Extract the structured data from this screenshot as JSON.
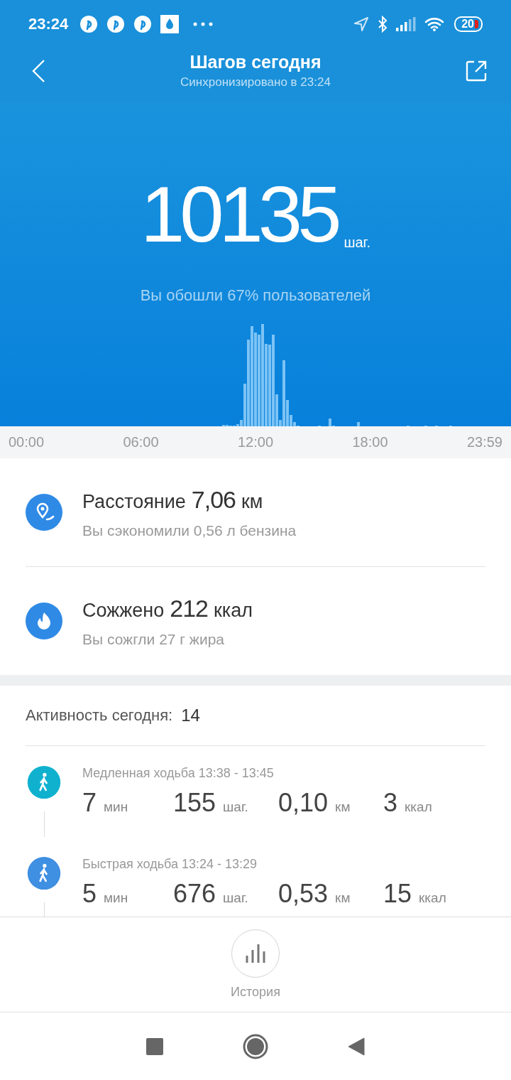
{
  "status_bar": {
    "time": "23:24",
    "battery": "20"
  },
  "header": {
    "title": "Шагов сегодня",
    "subtitle": "Синхронизировано в 23:24"
  },
  "steps": {
    "value": "10135",
    "unit": "шаг.",
    "comparison": "Вы обошли 67% пользователей"
  },
  "axis_labels": [
    "00:00",
    "06:00",
    "12:00",
    "18:00",
    "23:59"
  ],
  "stats": [
    {
      "kind": "distance",
      "label": "Расстояние",
      "value": "7,06",
      "unit": "км",
      "note": "Вы сэкономили 0,56 л бензина"
    },
    {
      "kind": "calories",
      "label": "Сожжено",
      "value": "212",
      "unit": "ккал",
      "note": "Вы сожгли 27 г жира"
    }
  ],
  "activity": {
    "label": "Активность сегодня:",
    "count": "14",
    "items": [
      {
        "title": "Медленная ходьба 13:38 - 13:45",
        "color": "#10b1cf",
        "metrics": [
          {
            "value": "7",
            "unit": "мин"
          },
          {
            "value": "155",
            "unit": "шаг."
          },
          {
            "value": "0,10",
            "unit": "км"
          },
          {
            "value": "3",
            "unit": "ккал"
          }
        ]
      },
      {
        "title": "Быстрая ходьба 13:24 - 13:29",
        "color": "#3f8fe2",
        "metrics": [
          {
            "value": "5",
            "unit": "мин"
          },
          {
            "value": "676",
            "unit": "шаг."
          },
          {
            "value": "0,53",
            "unit": "км"
          },
          {
            "value": "15",
            "unit": "ккал"
          }
        ]
      }
    ]
  },
  "history_button": {
    "label": "История"
  }
}
